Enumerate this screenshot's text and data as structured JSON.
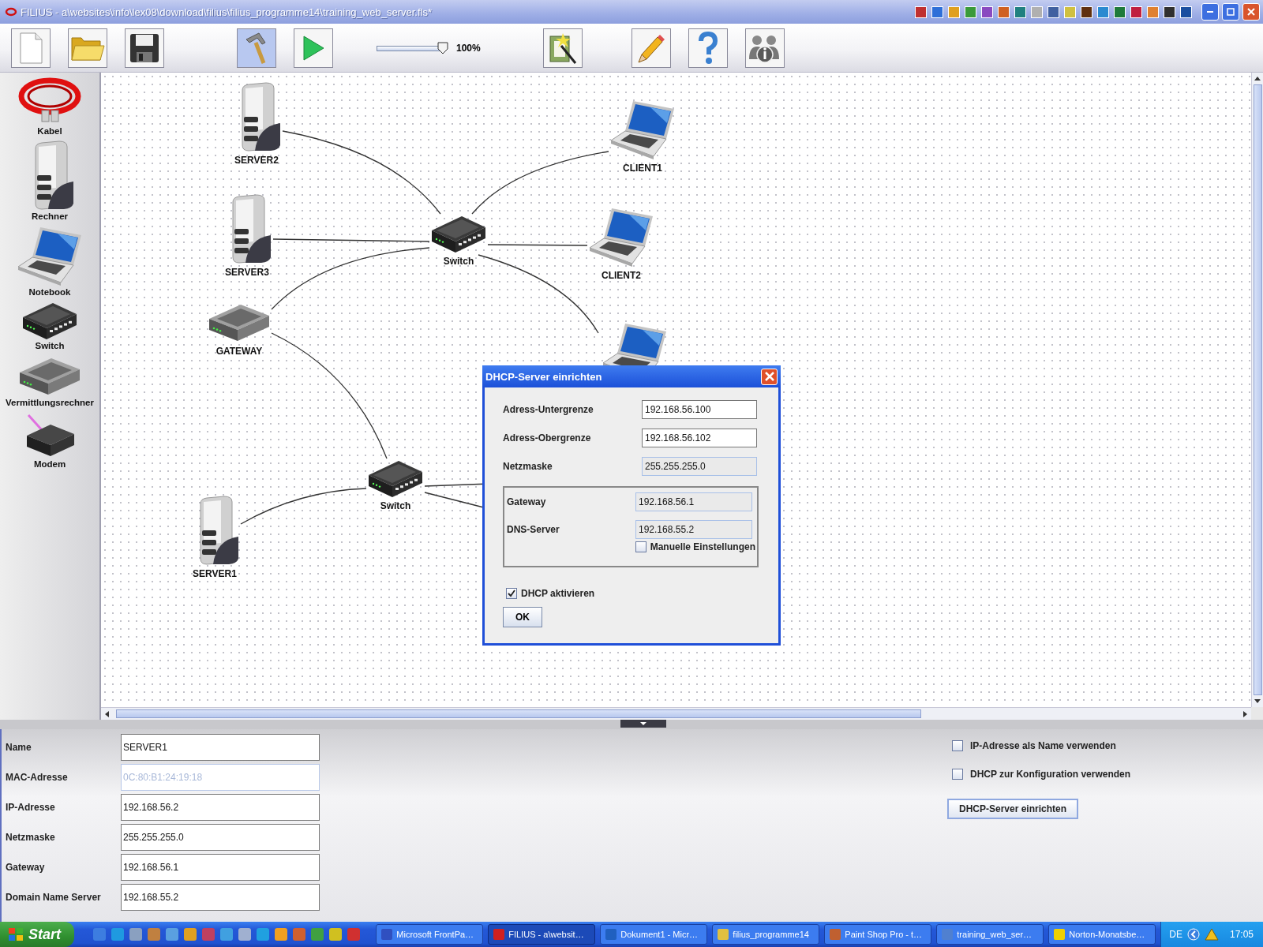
{
  "window": {
    "title": "FILIUS - a\\websites\\info\\lex08\\download\\filius\\filius_programme14\\training_web_server.fls*"
  },
  "toolbar": {
    "buttons": [
      {
        "kind": "new",
        "selected": false
      },
      {
        "kind": "open",
        "selected": false
      },
      {
        "kind": "save",
        "selected": false
      },
      {
        "kind": "design",
        "selected": true
      },
      {
        "kind": "run",
        "selected": false
      },
      {
        "kind": "wizard",
        "selected": false
      },
      {
        "kind": "edit",
        "selected": false
      },
      {
        "kind": "help",
        "selected": false
      },
      {
        "kind": "info",
        "selected": false
      }
    ],
    "zoom": {
      "level": 1,
      "reading": "100%"
    }
  },
  "palette": [
    {
      "kind": "cable",
      "label": "Kabel"
    },
    {
      "kind": "server",
      "label": "Rechner"
    },
    {
      "kind": "notebook",
      "label": "Notebook"
    },
    {
      "kind": "switch",
      "label": "Switch"
    },
    {
      "kind": "router",
      "label": "Vermittlungsrechner"
    },
    {
      "kind": "modem",
      "label": "Modem"
    }
  ],
  "network": {
    "nodes": [
      {
        "kind": "server",
        "label": "SERVER2"
      },
      {
        "kind": "server",
        "label": "SERVER3"
      },
      {
        "kind": "router",
        "label": "GATEWAY"
      },
      {
        "kind": "switch",
        "label": "Switch"
      },
      {
        "kind": "notebook",
        "label": "CLIENT1"
      },
      {
        "kind": "notebook",
        "label": "CLIENT2"
      },
      {
        "kind": "notebook"
      },
      {
        "kind": "switch",
        "label": "Switch"
      },
      {
        "kind": "server",
        "label": "SERVER1"
      }
    ]
  },
  "dialog": {
    "title": "DHCP-Server einrichten",
    "fields": [
      {
        "label": "Adress-Untergrenze",
        "value": "192.168.56.100",
        "disabled": false
      },
      {
        "label": "Adress-Obergrenze",
        "value": "192.168.56.102",
        "disabled": false
      },
      {
        "label": "Netzmaske",
        "value": "255.255.255.0",
        "disabled": true
      }
    ],
    "group": {
      "fields": [
        {
          "label": "Gateway",
          "value": "192.168.56.1",
          "disabled": true
        },
        {
          "label": "DNS-Server",
          "value": "192.168.55.2",
          "disabled": true
        }
      ],
      "manual": {
        "label": "Manuelle Einstellungen",
        "checked": false
      }
    },
    "dhcp": {
      "label": "DHCP aktivieren",
      "checked": true
    },
    "ok": "OK"
  },
  "properties": {
    "fields": [
      {
        "label": "Name",
        "value": "SERVER1",
        "disabled": false
      },
      {
        "label": "MAC-Adresse",
        "value": "0C:80:B1:24:19:18",
        "disabled": true
      },
      {
        "label": "IP-Adresse",
        "value": "192.168.56.2",
        "disabled": false
      },
      {
        "label": "Netzmaske",
        "value": "255.255.255.0",
        "disabled": false
      },
      {
        "label": "Gateway",
        "value": "192.168.56.1",
        "disabled": false
      },
      {
        "label": "Domain Name Server",
        "value": "192.168.55.2",
        "disabled": false
      }
    ],
    "options": [
      {
        "label": "IP-Adresse als Name verwenden",
        "checked": false
      },
      {
        "label": "DHCP zur Konfiguration verwenden",
        "checked": false
      }
    ],
    "button": "DHCP-Server einrichten"
  },
  "taskbar": {
    "start": "Start",
    "tasks": [
      {
        "label": "Microsoft FrontPa…",
        "selected": false
      },
      {
        "label": "FILIUS - a\\websit…",
        "selected": true
      },
      {
        "label": "Dokument1 - Micr…",
        "selected": false
      },
      {
        "label": "filius_programme14",
        "selected": false
      },
      {
        "label": "Paint Shop Pro - t…",
        "selected": false
      },
      {
        "label": "training_web_ser…",
        "selected": false
      },
      {
        "label": "Norton-Monatsbe…",
        "selected": false
      }
    ],
    "language": "DE",
    "clock": "17:05"
  }
}
